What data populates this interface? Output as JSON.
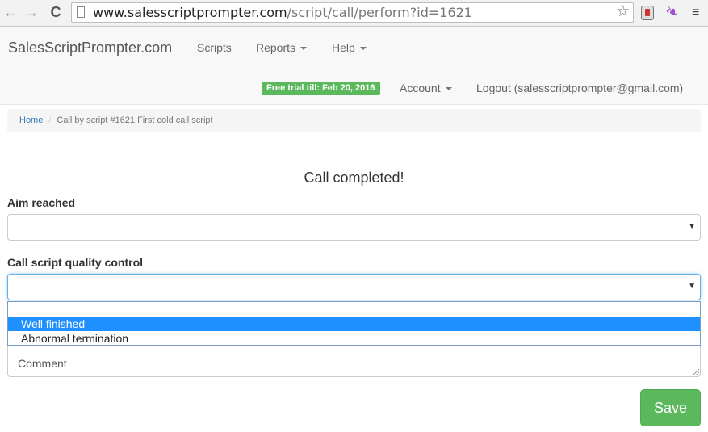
{
  "browser": {
    "url_domain": "www.salesscriptprompter.com",
    "url_path": "/script/call/perform?id=1621",
    "back_icon": "←",
    "forward_icon": "→",
    "reload_icon": "C",
    "star_icon": "☆",
    "menu_icon": "≡"
  },
  "navbar": {
    "brand": "SalesScriptPrompter.com",
    "links": [
      "Scripts",
      "Reports",
      "Help"
    ],
    "trial_badge": "Free trial till: Feb 20, 2016",
    "account": "Account",
    "logout": "Logout (salesscriptprompter@gmail.com)",
    "badge_color": "#5cb85c"
  },
  "breadcrumb": {
    "home": "Home",
    "separator": "/",
    "current": "Call by script #1621 First cold call script"
  },
  "form": {
    "title": "Call completed!",
    "aim_label": "Aim reached",
    "aim_value": "",
    "quality_label": "Call script quality control",
    "quality_value": "",
    "quality_options": [
      "",
      "Well finished",
      "Abnormal termination"
    ],
    "highlighted_option": "Well finished",
    "comment_placeholder": "Comment",
    "save_label": "Save",
    "select_arrow": "▼"
  }
}
